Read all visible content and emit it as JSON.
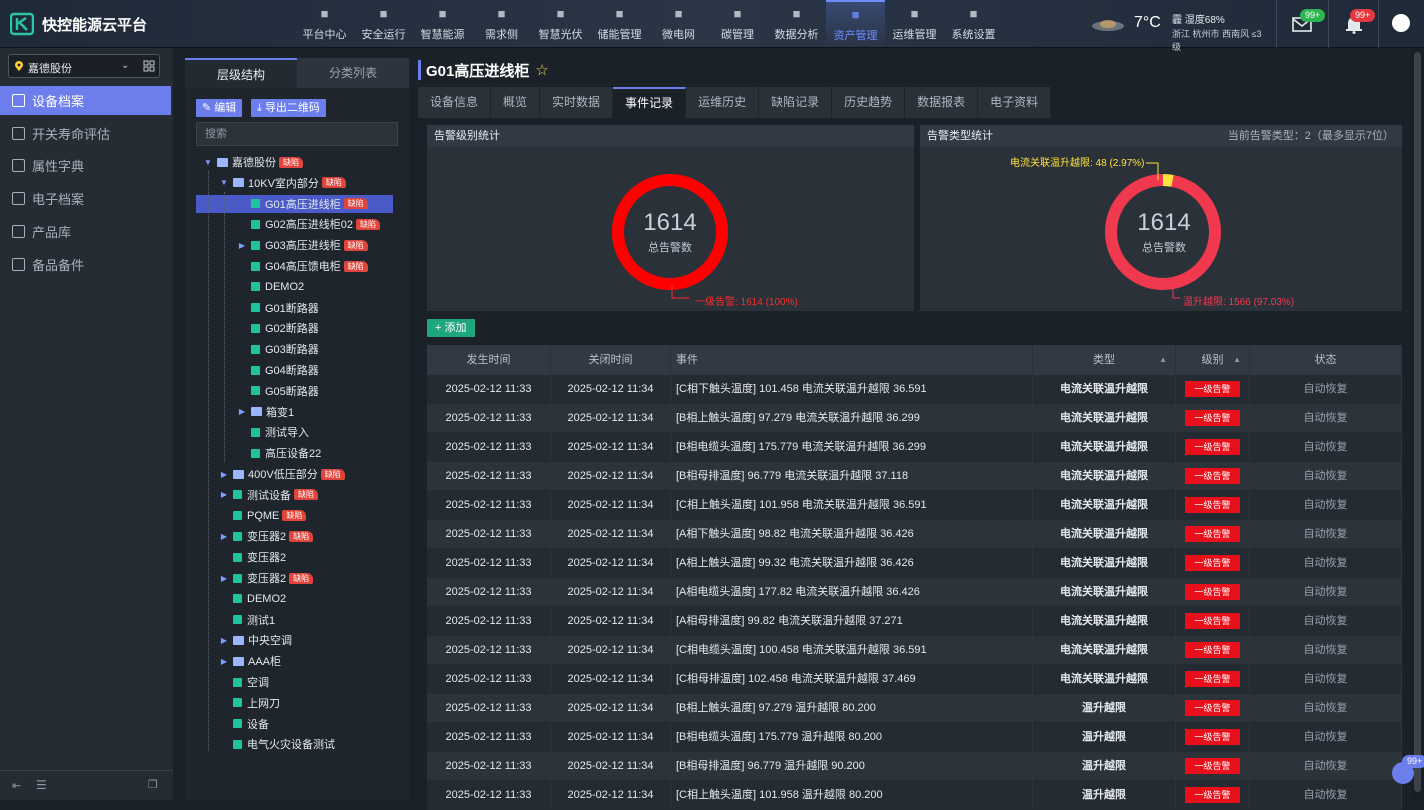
{
  "app": {
    "brand": "快控能源云平台"
  },
  "nav": [
    {
      "label": "平台中心",
      "icon": "platform-icon"
    },
    {
      "label": "安全运行",
      "icon": "shield-icon"
    },
    {
      "label": "智慧能源",
      "icon": "recycle-icon"
    },
    {
      "label": "需求侧",
      "icon": "demand-icon"
    },
    {
      "label": "智慧光伏",
      "icon": "solar-panel-icon"
    },
    {
      "label": "储能管理",
      "icon": "battery-icon"
    },
    {
      "label": "微电网",
      "icon": "microgrid-icon"
    },
    {
      "label": "碳管理",
      "icon": "leaf-icon"
    },
    {
      "label": "数据分析",
      "icon": "pie-chart-icon"
    },
    {
      "label": "资产管理",
      "icon": "database-icon"
    },
    {
      "label": "运维管理",
      "icon": "tools-icon"
    },
    {
      "label": "系统设置",
      "icon": "gear-icon"
    }
  ],
  "nav_active": "资产管理",
  "weather": {
    "temp": "7°C",
    "condition": "霾",
    "humidity": "湿度68%",
    "region": "浙江",
    "city": "杭州市",
    "wind": "西南风",
    "level": "≤3级"
  },
  "header": {
    "mail_badge": "99+",
    "bell_badge": "99+",
    "float_badge": "99+"
  },
  "sidebar": {
    "company": "嘉德股份",
    "items": [
      {
        "label": "设备档案",
        "icon": "device-file-icon",
        "active": true
      },
      {
        "label": "开关寿命评估",
        "icon": "switch-life-icon"
      },
      {
        "label": "属性字典",
        "icon": "dictionary-icon"
      },
      {
        "label": "电子档案",
        "icon": "e-archive-icon"
      },
      {
        "label": "产品库",
        "icon": "product-icon"
      },
      {
        "label": "备品备件",
        "icon": "spare-parts-icon"
      }
    ]
  },
  "tree_panel": {
    "tabs": [
      "层级结构",
      "分类列表"
    ],
    "edit": "编辑",
    "export": "导出二维码",
    "search_placeholder": "搜索",
    "defect_badge": "缺陷",
    "nodes": [
      {
        "label": "嘉德股份",
        "depth": 0,
        "kind": "folder",
        "arrow": "▼",
        "badge": true
      },
      {
        "label": "10KV室内部分",
        "depth": 1,
        "kind": "folder",
        "arrow": "▼",
        "badge": true
      },
      {
        "label": "G01高压进线柜",
        "depth": 2,
        "kind": "device",
        "badge": true,
        "selected": true
      },
      {
        "label": "G02高压进线柜02",
        "depth": 2,
        "kind": "device",
        "badge": true
      },
      {
        "label": "G03高压进线柜",
        "depth": 2,
        "kind": "device",
        "arrow": "▶",
        "badge": true
      },
      {
        "label": "G04高压馈电柜",
        "depth": 2,
        "kind": "device",
        "badge": true
      },
      {
        "label": "DEMO2",
        "depth": 2,
        "kind": "device"
      },
      {
        "label": "G01断路器",
        "depth": 2,
        "kind": "device"
      },
      {
        "label": "G02断路器",
        "depth": 2,
        "kind": "device"
      },
      {
        "label": "G03断路器",
        "depth": 2,
        "kind": "device"
      },
      {
        "label": "G04断路器",
        "depth": 2,
        "kind": "device"
      },
      {
        "label": "G05断路器",
        "depth": 2,
        "kind": "device"
      },
      {
        "label": "箱变1",
        "depth": 2,
        "kind": "folder",
        "arrow": "▶"
      },
      {
        "label": "测试导入",
        "depth": 2,
        "kind": "device"
      },
      {
        "label": "高压设备22",
        "depth": 2,
        "kind": "device"
      },
      {
        "label": "400V低压部分",
        "depth": 1,
        "kind": "folder",
        "arrow": "▶",
        "badge": true
      },
      {
        "label": "测试设备",
        "depth": 1,
        "kind": "device",
        "arrow": "▶",
        "badge": true
      },
      {
        "label": "PQME",
        "depth": 1,
        "kind": "device",
        "badge": true
      },
      {
        "label": "变压器2",
        "depth": 1,
        "kind": "device",
        "arrow": "▶",
        "badge": true
      },
      {
        "label": "变压器2",
        "depth": 1,
        "kind": "device"
      },
      {
        "label": "变压器2",
        "depth": 1,
        "kind": "device",
        "arrow": "▶",
        "badge": true
      },
      {
        "label": "DEMO2",
        "depth": 1,
        "kind": "device"
      },
      {
        "label": "测试1",
        "depth": 1,
        "kind": "device"
      },
      {
        "label": "中央空调",
        "depth": 1,
        "kind": "folder",
        "arrow": "▶"
      },
      {
        "label": "AAA柜",
        "depth": 1,
        "kind": "folder",
        "arrow": "▶"
      },
      {
        "label": "空调",
        "depth": 1,
        "kind": "device"
      },
      {
        "label": "上网刀",
        "depth": 1,
        "kind": "device"
      },
      {
        "label": "设备",
        "depth": 1,
        "kind": "device"
      },
      {
        "label": "电气火灾设备测试",
        "depth": 1,
        "kind": "device"
      }
    ]
  },
  "main": {
    "title": "G01高压进线柜",
    "tabs": [
      "设备信息",
      "概览",
      "实时数据",
      "事件记录",
      "运维历史",
      "缺陷记录",
      "历史趋势",
      "数据报表",
      "电子资料"
    ],
    "active_tab": "事件记录",
    "add_button": "添加"
  },
  "chart_data": [
    {
      "type": "pie",
      "title": "告警级别统计",
      "center_value": "1614",
      "center_label": "总告警数",
      "slices": [
        {
          "label": "一级告警",
          "value": 1614,
          "percent": 100,
          "color": "#ff0000",
          "callout": "一级告警: 1614 (100%)"
        }
      ]
    },
    {
      "type": "pie",
      "title": "告警类型统计",
      "extra": "当前告警类型：2（最多显示7位）",
      "center_value": "1614",
      "center_label": "总告警数",
      "slices": [
        {
          "label": "电流关联温升越限",
          "value": 48,
          "percent": 2.97,
          "color": "#ffe13b",
          "callout": "电流关联温升越限: 48 (2.97%)"
        },
        {
          "label": "温升越限",
          "value": 1566,
          "percent": 97.03,
          "color": "#f0394f",
          "callout": "温升越限: 1566 (97.03%)"
        }
      ]
    }
  ],
  "table": {
    "headers": [
      "发生时间",
      "关闭时间",
      "事件",
      "类型",
      "级别",
      "状态"
    ],
    "rows": [
      [
        "2025-02-12 11:33",
        "2025-02-12 11:34",
        "[C相下触头温度] 101.458 电流关联温升越限 36.591",
        "电流关联温升越限",
        "一级告警",
        "自动恢复"
      ],
      [
        "2025-02-12 11:33",
        "2025-02-12 11:34",
        "[B相上触头温度] 97.279 电流关联温升越限 36.299",
        "电流关联温升越限",
        "一级告警",
        "自动恢复"
      ],
      [
        "2025-02-12 11:33",
        "2025-02-12 11:34",
        "[B相电缆头温度] 175.779 电流关联温升越限 36.299",
        "电流关联温升越限",
        "一级告警",
        "自动恢复"
      ],
      [
        "2025-02-12 11:33",
        "2025-02-12 11:34",
        "[B相母排温度] 96.779 电流关联温升越限 37.118",
        "电流关联温升越限",
        "一级告警",
        "自动恢复"
      ],
      [
        "2025-02-12 11:33",
        "2025-02-12 11:34",
        "[C相上触头温度] 101.958 电流关联温升越限 36.591",
        "电流关联温升越限",
        "一级告警",
        "自动恢复"
      ],
      [
        "2025-02-12 11:33",
        "2025-02-12 11:34",
        "[A相下触头温度] 98.82 电流关联温升越限 36.426",
        "电流关联温升越限",
        "一级告警",
        "自动恢复"
      ],
      [
        "2025-02-12 11:33",
        "2025-02-12 11:34",
        "[A相上触头温度] 99.32 电流关联温升越限 36.426",
        "电流关联温升越限",
        "一级告警",
        "自动恢复"
      ],
      [
        "2025-02-12 11:33",
        "2025-02-12 11:34",
        "[A相电缆头温度] 177.82 电流关联温升越限 36.426",
        "电流关联温升越限",
        "一级告警",
        "自动恢复"
      ],
      [
        "2025-02-12 11:33",
        "2025-02-12 11:34",
        "[A相母排温度] 99.82 电流关联温升越限 37.271",
        "电流关联温升越限",
        "一级告警",
        "自动恢复"
      ],
      [
        "2025-02-12 11:33",
        "2025-02-12 11:34",
        "[C相电缆头温度] 100.458 电流关联温升越限 36.591",
        "电流关联温升越限",
        "一级告警",
        "自动恢复"
      ],
      [
        "2025-02-12 11:33",
        "2025-02-12 11:34",
        "[C相母排温度] 102.458 电流关联温升越限 37.469",
        "电流关联温升越限",
        "一级告警",
        "自动恢复"
      ],
      [
        "2025-02-12 11:33",
        "2025-02-12 11:34",
        "[B相上触头温度] 97.279 温升越限 80.200",
        "温升越限",
        "一级告警",
        "自动恢复"
      ],
      [
        "2025-02-12 11:33",
        "2025-02-12 11:34",
        "[B相电缆头温度] 175.779 温升越限 80.200",
        "温升越限",
        "一级告警",
        "自动恢复"
      ],
      [
        "2025-02-12 11:33",
        "2025-02-12 11:34",
        "[B相母排温度] 96.779 温升越限 90.200",
        "温升越限",
        "一级告警",
        "自动恢复"
      ],
      [
        "2025-02-12 11:33",
        "2025-02-12 11:34",
        "[C相上触头温度] 101.958 温升越限 80.200",
        "温升越限",
        "一级告警",
        "自动恢复"
      ]
    ]
  }
}
